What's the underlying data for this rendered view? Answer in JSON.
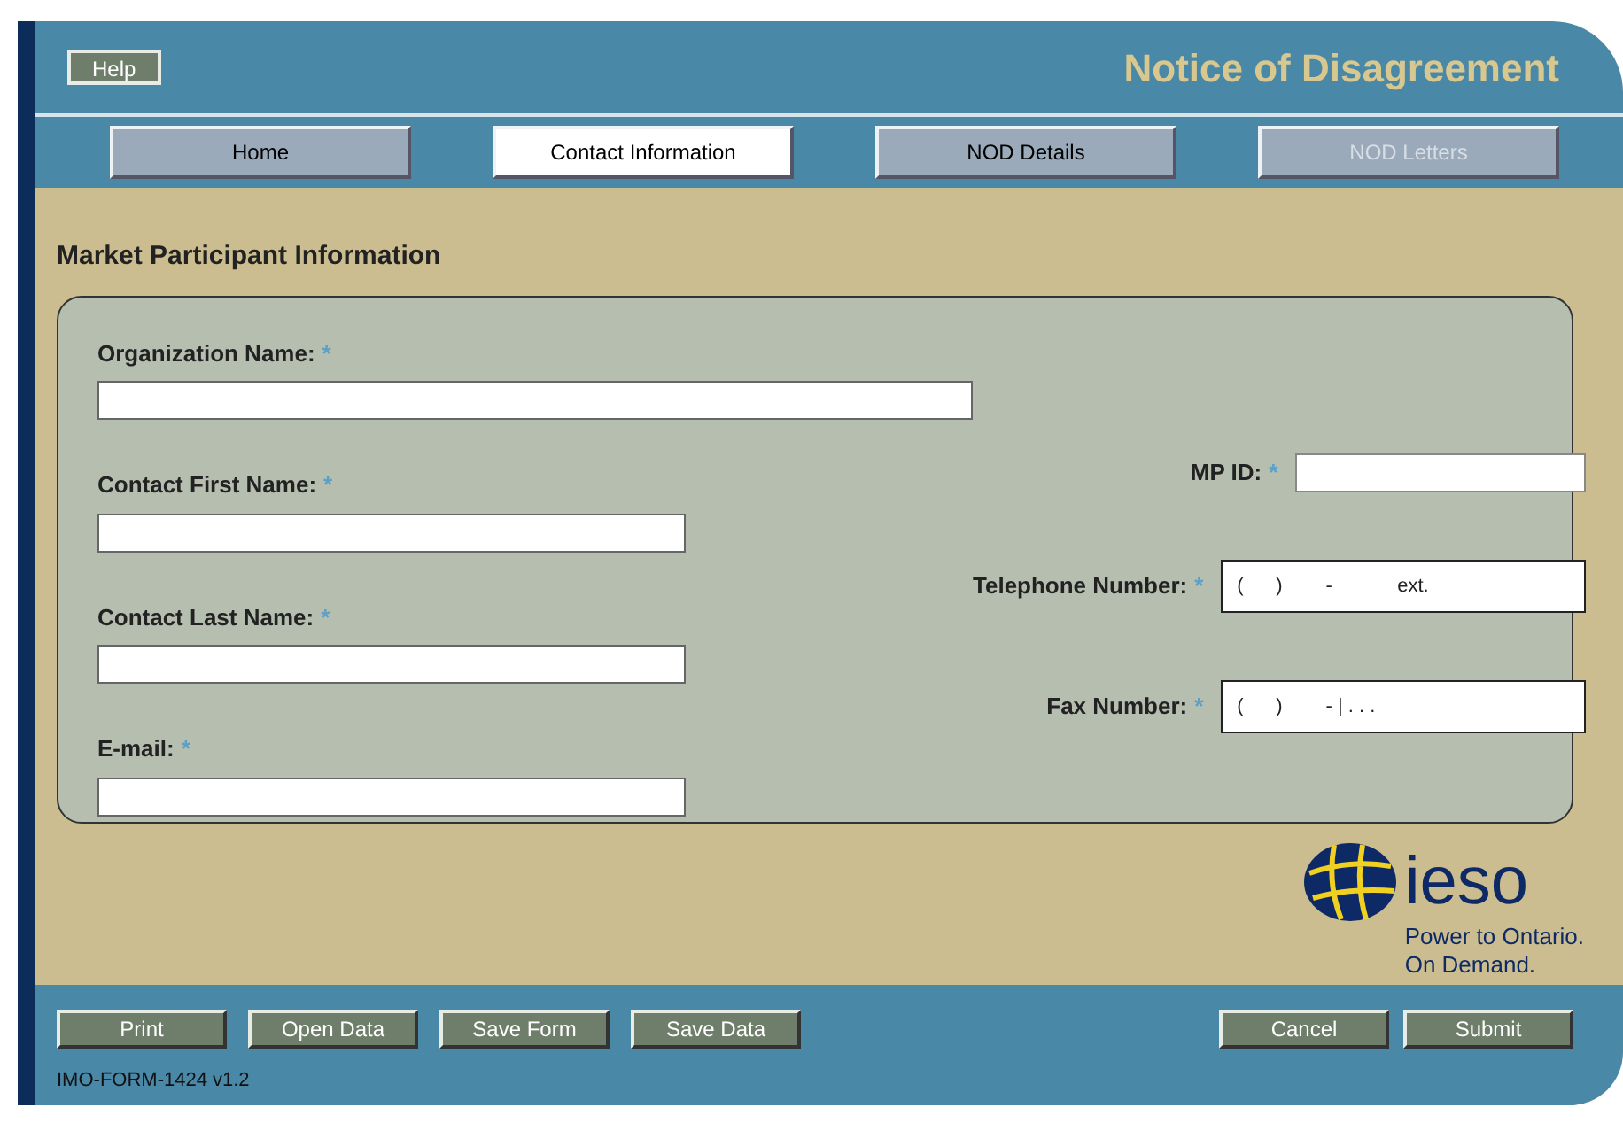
{
  "header": {
    "help_button": "Help",
    "title": "Notice of Disagreement"
  },
  "tabs": [
    {
      "label": "Home",
      "selected": false,
      "disabled": false
    },
    {
      "label": "Contact Information",
      "selected": true,
      "disabled": false
    },
    {
      "label": "NOD Details",
      "selected": false,
      "disabled": false
    },
    {
      "label": "NOD Letters",
      "selected": false,
      "disabled": true
    }
  ],
  "section_title": "Market Participant Information",
  "required_mark": "*",
  "left_fields": [
    {
      "label": "Organization Name:"
    },
    {
      "label": "Contact First Name:"
    },
    {
      "label": "Contact Last Name:"
    },
    {
      "label": "E-mail:"
    }
  ],
  "right_fields": [
    {
      "label": "MP ID:"
    },
    {
      "label": "Telephone Number:",
      "value": "(      )        -            ext."
    },
    {
      "label": "Fax Number:",
      "value": "(      )        - | . . ."
    }
  ],
  "logo": {
    "name": "ieso",
    "tagline": [
      "Power to Ontario.",
      "On Demand."
    ]
  },
  "footer": {
    "left_buttons": [
      "Print",
      "Open Data",
      "Save Form",
      "Save Data"
    ],
    "right_buttons": [
      "Cancel",
      "Submit"
    ],
    "form_id": "IMO-FORM-1424 v1.2"
  }
}
